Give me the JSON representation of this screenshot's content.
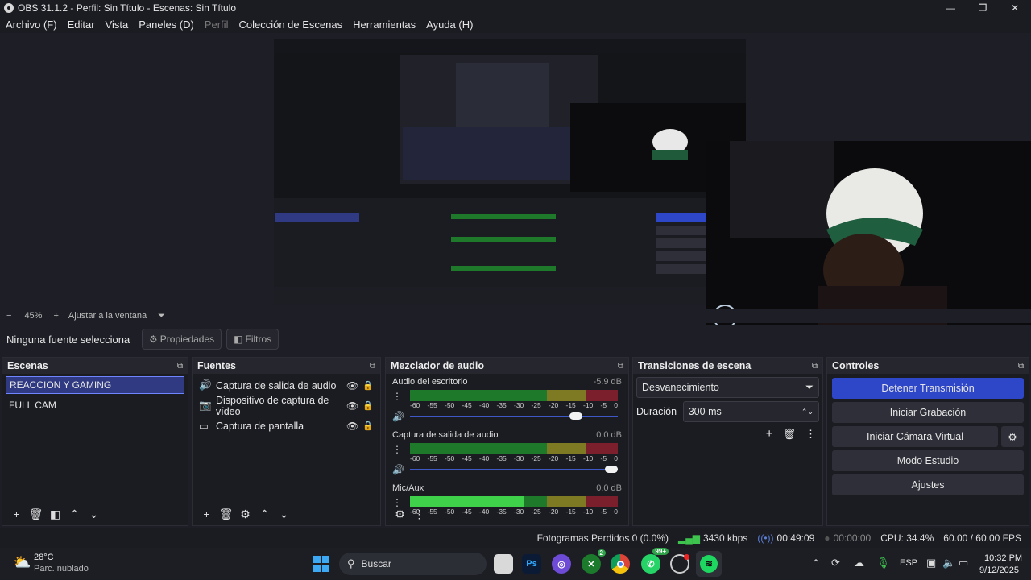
{
  "window": {
    "title": "OBS 31.1.2 - Perfil: Sin Título - Escenas: Sin Título",
    "minimize": "—",
    "maximize": "❐",
    "close": "✕"
  },
  "menu": [
    "Archivo (F)",
    "Editar",
    "Vista",
    "Paneles (D)",
    "Perfil",
    "Colección de Escenas",
    "Herramientas",
    "Ayuda (H)"
  ],
  "zoom": {
    "minus": "−",
    "level": "45%",
    "plus": "+",
    "fit_label": "Ajustar a la ventana",
    "dropdown": "⏷"
  },
  "properties_bar": {
    "no_source": "Ninguna fuente selecciona",
    "properties": "Propiedades",
    "filters": "Filtros"
  },
  "scenes": {
    "title": "Escenas",
    "items": [
      "REACCION Y GAMING",
      "FULL CAM"
    ],
    "selected": 0
  },
  "sources": {
    "title": "Fuentes",
    "items": [
      {
        "icon": "speaker-icon",
        "label": "Captura de salida de audio"
      },
      {
        "icon": "camera-icon",
        "label": "Dispositivo de captura de vídeo"
      },
      {
        "icon": "monitor-icon",
        "label": "Captura de pantalla"
      }
    ]
  },
  "mixer": {
    "title": "Mezclador de audio",
    "scale": [
      "-60",
      "-55",
      "-50",
      "-45",
      "-40",
      "-35",
      "-30",
      "-25",
      "-20",
      "-15",
      "-10",
      "-5",
      "0"
    ],
    "tracks": [
      {
        "name": "Audio del escritorio",
        "db": "-5.9 dB",
        "volume": 0.82
      },
      {
        "name": "Captura de salida de audio",
        "db": "0.0 dB",
        "volume": 1.0
      },
      {
        "name": "Mic/Aux",
        "db": "0.0 dB",
        "level": 0.55
      }
    ]
  },
  "transitions": {
    "title": "Transiciones de escena",
    "selected": "Desvanecimiento",
    "duration_label": "Duración",
    "duration": "300 ms"
  },
  "controls": {
    "title": "Controles",
    "stop_stream": "Detener Transmisión",
    "start_rec": "Iniciar Grabación",
    "virtual_cam": "Iniciar Cámara Virtual",
    "studio": "Modo Estudio",
    "settings": "Ajustes"
  },
  "status": {
    "dropped": "Fotogramas Perdidos 0 (0.0%)",
    "bitrate": "3430 kbps",
    "stream_time": "00:49:09",
    "rec_time": "00:00:00",
    "cpu": "CPU: 34.4%",
    "fps": "60.00 / 60.00 FPS"
  },
  "taskbar": {
    "temp": "28°C",
    "weather": "Parc. nublado",
    "search": "Buscar",
    "lang": "ESP",
    "time": "10:32 PM",
    "date": "9/12/2025",
    "whatsapp_badge": "99+",
    "xbox_badge": "2"
  },
  "colors": {
    "accent": "#2e46c8",
    "selection": "#2f3a82",
    "meter_green": "#1e7a2a",
    "meter_yellow": "#7e7a23",
    "meter_red": "#7a1f2b"
  }
}
